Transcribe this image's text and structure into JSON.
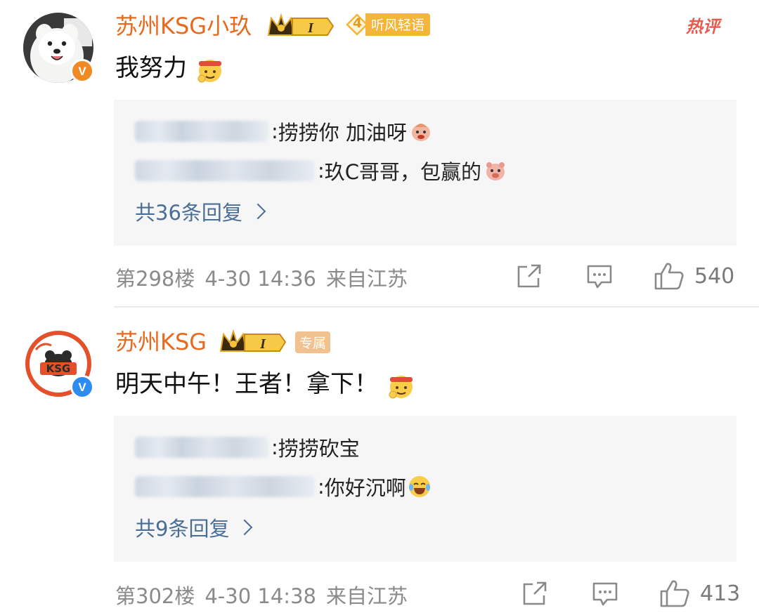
{
  "comments": [
    {
      "user": "苏州KSG小玖",
      "fan_badge": {
        "level": "4",
        "label": "听风轻语"
      },
      "hot_label": "热评",
      "text": "我努力",
      "replies": [
        {
          "sep": ": ",
          "text": "捞捞你 加油呀"
        },
        {
          "sep": ": ",
          "text": "玖C哥哥，包赢的"
        }
      ],
      "more_replies": "共36条回复",
      "floor": "第298楼",
      "time": "4-30 14:36",
      "location": "来自江苏",
      "likes": "540"
    },
    {
      "user": "苏州KSG",
      "tag": "专属",
      "text": "明天中午！王者！拿下！",
      "replies": [
        {
          "sep": ": ",
          "text": "捞捞砍宝"
        },
        {
          "sep": ": ",
          "text": "你好沉啊"
        }
      ],
      "more_replies": "共9条回复",
      "floor": "第302楼",
      "time": "4-30 14:38",
      "location": "来自江苏",
      "likes": "413"
    }
  ],
  "icons": {
    "crown": "crown-level-icon",
    "share": "share-icon",
    "comment": "comment-icon",
    "like": "thumbs-up-icon"
  },
  "colors": {
    "username": "#e86a1e",
    "link": "#4a6e96",
    "hot": "#e85a4f",
    "verified_orange": "#f08a24",
    "verified_blue": "#2d8cf0",
    "fan_badge": "#f5b43a",
    "tag": "#e6a05a"
  }
}
